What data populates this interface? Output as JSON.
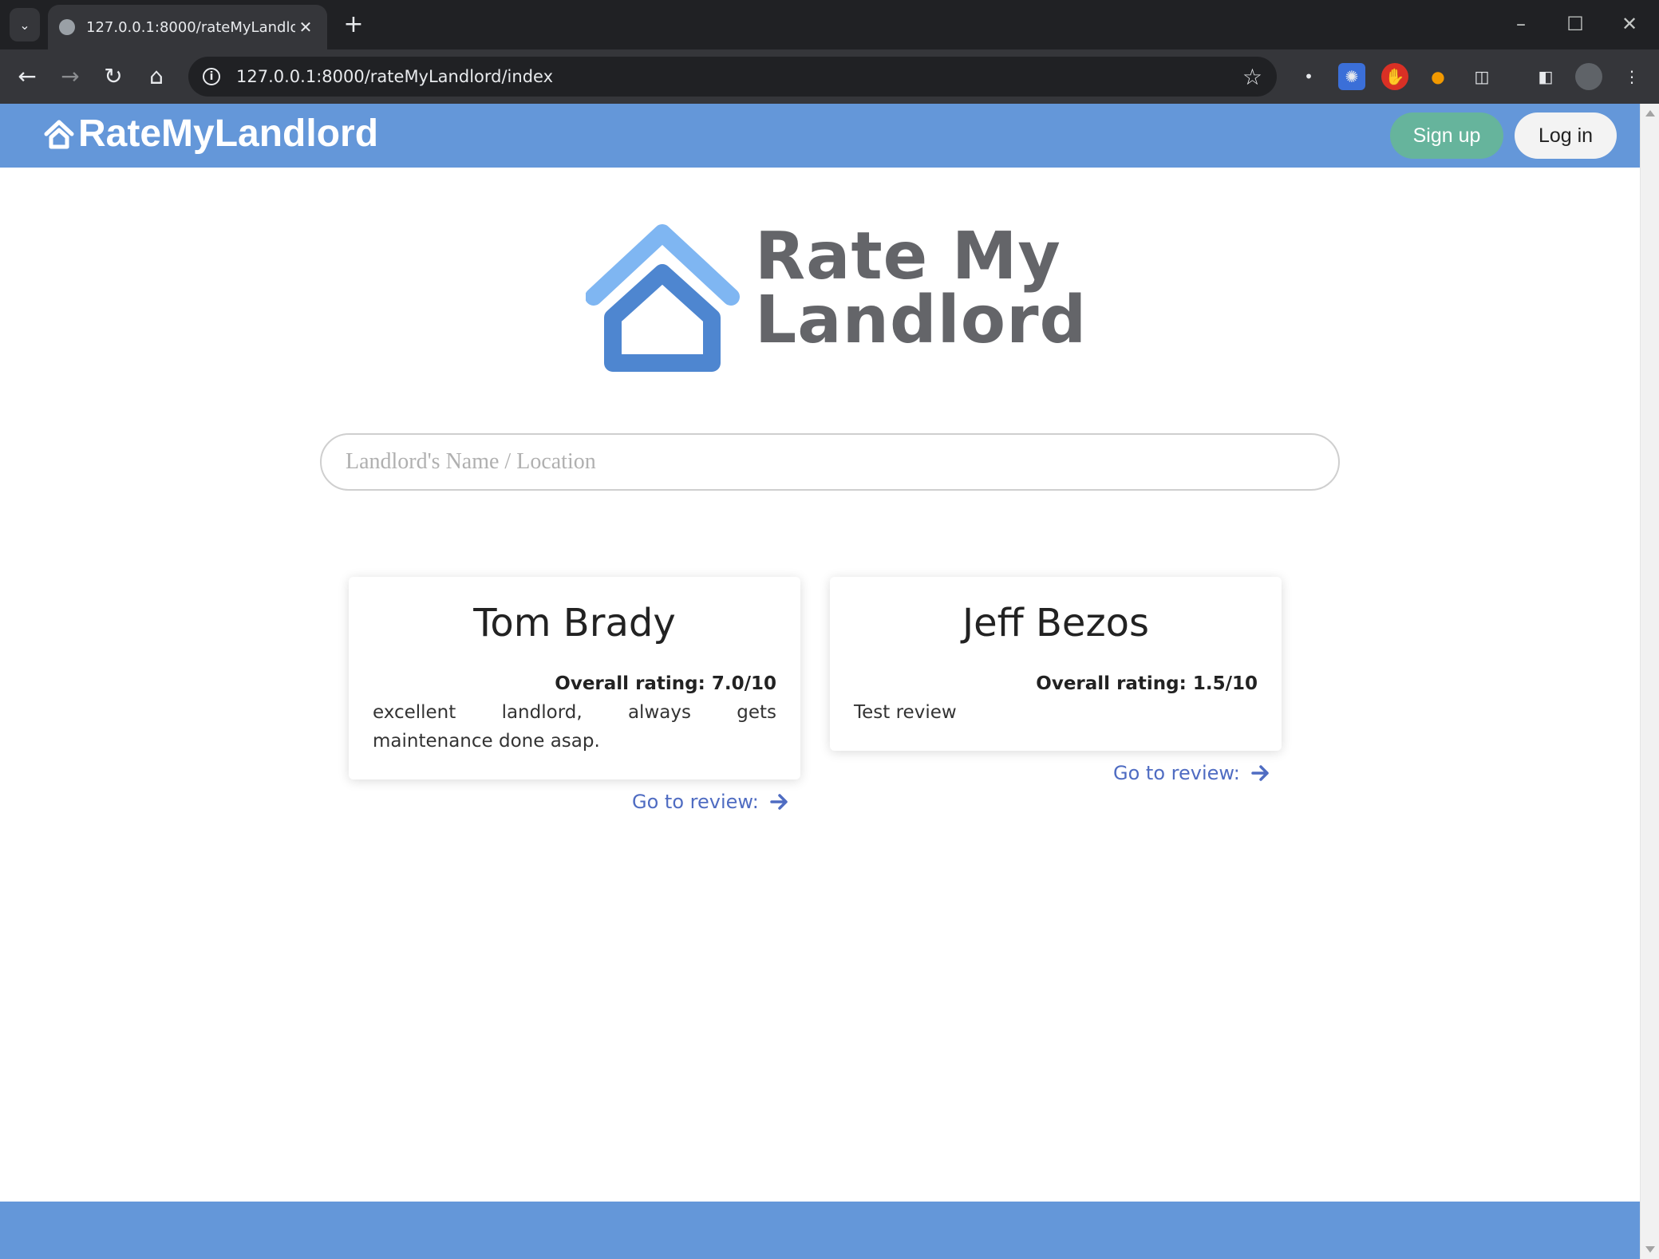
{
  "browser": {
    "tab_title": "127.0.0.1:8000/rateMyLandlord/",
    "url": "127.0.0.1:8000/rateMyLandlord/index"
  },
  "header": {
    "brand": "RateMyLandlord",
    "signup_label": "Sign up",
    "login_label": "Log in"
  },
  "hero": {
    "line1": "Rate My",
    "line2": "Landlord"
  },
  "search": {
    "placeholder": "Landlord's Name / Location",
    "value": ""
  },
  "cards": [
    {
      "name": "Tom Brady",
      "rating": "Overall rating: 7.0/10",
      "review": "excellent landlord, always gets maintenance done asap.",
      "link": "Go to review:"
    },
    {
      "name": "Jeff Bezos",
      "rating": "Overall rating: 1.5/10",
      "review": "Test review",
      "link": "Go to review:"
    }
  ],
  "colors": {
    "header_bg": "#6497d9",
    "signup_bg": "#66b49c",
    "link": "#4f6cc2",
    "logo_light": "#7fb6f2",
    "logo_dark": "#4e86d0",
    "logo_text": "#646569"
  }
}
